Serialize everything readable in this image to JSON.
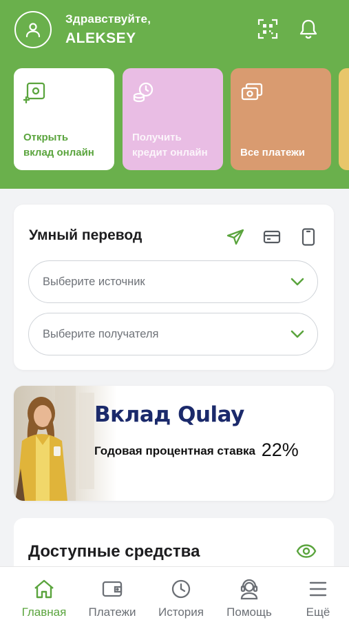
{
  "header": {
    "greeting": "Здравствуйте,",
    "user_name": "ALEKSEY",
    "icons": [
      "user-icon",
      "qr-scan-icon",
      "bell-icon"
    ]
  },
  "quick_actions": [
    {
      "label_line1": "Открыть",
      "label_line2": "вклад онлайн",
      "icon": "deposit-icon",
      "color": "#ffffff"
    },
    {
      "label_line1": "Получить",
      "label_line2": "кредит онлайн",
      "icon": "credit-icon",
      "color": "#e9bde4"
    },
    {
      "label_line1": "Все платежи",
      "icon": "payments-icon",
      "color": "#d99b70"
    }
  ],
  "smart_transfer": {
    "title": "Умный перевод",
    "source_placeholder": "Выберите источник",
    "recipient_placeholder": "Выберите получателя",
    "icons": [
      "send-icon",
      "card-icon",
      "phone-icon"
    ]
  },
  "promo": {
    "title": "Вклад Qulay",
    "subtitle": "Годовая процентная ставка",
    "rate": "22%"
  },
  "available_funds": {
    "title": "Доступные средства",
    "icon": "eye-icon"
  },
  "tabbar": {
    "tabs": [
      {
        "label": "Главная",
        "icon": "home-icon",
        "active": true
      },
      {
        "label": "Платежи",
        "icon": "wallet-icon",
        "active": false
      },
      {
        "label": "История",
        "icon": "clock-icon",
        "active": false
      },
      {
        "label": "Помощь",
        "icon": "support-icon",
        "active": false
      },
      {
        "label": "Ещё",
        "icon": "menu-icon",
        "active": false
      }
    ]
  },
  "colors": {
    "brand_green": "#6ab04c",
    "accent_green": "#5aa43d",
    "promo_blue": "#1b2a6b"
  }
}
